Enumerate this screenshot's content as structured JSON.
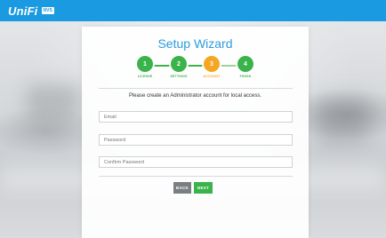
{
  "header": {
    "logo_text": "UniFi",
    "logo_badge": "NVS",
    "bar_color": "#1a9ae0"
  },
  "wizard": {
    "title": "Setup Wizard",
    "steps": [
      {
        "number": "1",
        "label": "LICENSE",
        "state": "done"
      },
      {
        "number": "2",
        "label": "SETTINGS",
        "state": "done"
      },
      {
        "number": "3",
        "label": "ACCOUNT",
        "state": "active"
      },
      {
        "number": "4",
        "label": "FINISH",
        "state": "pending"
      }
    ],
    "instruction": "Please create an Administrator account for local access.",
    "fields": {
      "email_placeholder": "Email",
      "password_placeholder": "Password",
      "confirm_placeholder": "Confirm Password"
    },
    "buttons": {
      "back_label": "BACK",
      "next_label": "NEXT"
    },
    "colors": {
      "done": "#3ab34a",
      "active": "#f5a623",
      "title": "#2d9bdc"
    }
  }
}
